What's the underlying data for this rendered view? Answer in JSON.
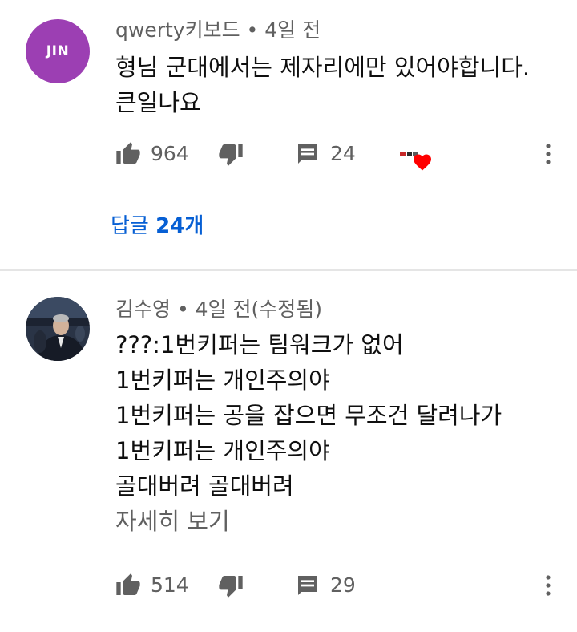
{
  "comments": [
    {
      "avatar_text": "JIN",
      "author": "qwerty키보드",
      "separator": "•",
      "time": "4일 전",
      "lines": [
        "형님 군대에서는 제자리에만 있어야합니다.",
        "큰일나요"
      ],
      "likes": "964",
      "replies_count": "24",
      "creator_heart": true,
      "replies_link_prefix": "답글",
      "replies_link_count": "24개"
    },
    {
      "author": "김수영",
      "separator": "•",
      "time": "4일 전(수정됨)",
      "lines": [
        "???:1번키퍼는 팀워크가 없어",
        "1번키퍼는 개인주의야",
        "1번키퍼는 공을 잡으면 무조건 달려나가",
        "1번키퍼는 개인주의야",
        "골대버려 골대버려"
      ],
      "read_more": "자세히 보기",
      "likes": "514",
      "replies_count": "29"
    }
  ],
  "icons": {
    "like": "thumbs-up-icon",
    "dislike": "thumbs-down-icon",
    "reply": "comment-icon",
    "more": "more-vertical-icon",
    "heart": "creator-heart-icon"
  },
  "colors": {
    "link": "#065fd4",
    "meta": "#606060",
    "avatar_jin": "#9c3fb3",
    "heart": "#ff0000"
  }
}
